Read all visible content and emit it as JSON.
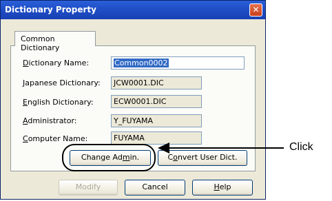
{
  "window": {
    "title": "Dictionary Property",
    "close_glyph": "✕"
  },
  "tab": {
    "label": "Common Dictionary"
  },
  "fields": {
    "dictionary_name": {
      "label_pre": "",
      "label_key": "D",
      "label_rest": "ictionary Name:",
      "value": "Common0002"
    },
    "japanese_dictionary": {
      "label_pre": "",
      "label_key": "J",
      "label_rest": "apanese Dictionary:",
      "value": "JCW0001.DIC"
    },
    "english_dictionary": {
      "label_pre": "",
      "label_key": "E",
      "label_rest": "nglish Dictionary:",
      "value": "ECW0001.DIC"
    },
    "administrator": {
      "label_pre": "",
      "label_key": "A",
      "label_rest": "dministrator:",
      "value": "Y_FUYAMA"
    },
    "computer_name": {
      "label_pre": "",
      "label_key": "C",
      "label_rest": "omputer Name:",
      "value": "FUYAMA"
    }
  },
  "buttons": {
    "change_admin": {
      "pre": "Change Ad",
      "key": "m",
      "post": "in."
    },
    "convert_user_dict": {
      "pre": "C",
      "key": "o",
      "post": "nvert User Dict."
    },
    "modify": "Modify",
    "cancel": "Cancel",
    "help": {
      "key": "H",
      "post": "elp"
    }
  },
  "annotation": {
    "label": "Click"
  }
}
